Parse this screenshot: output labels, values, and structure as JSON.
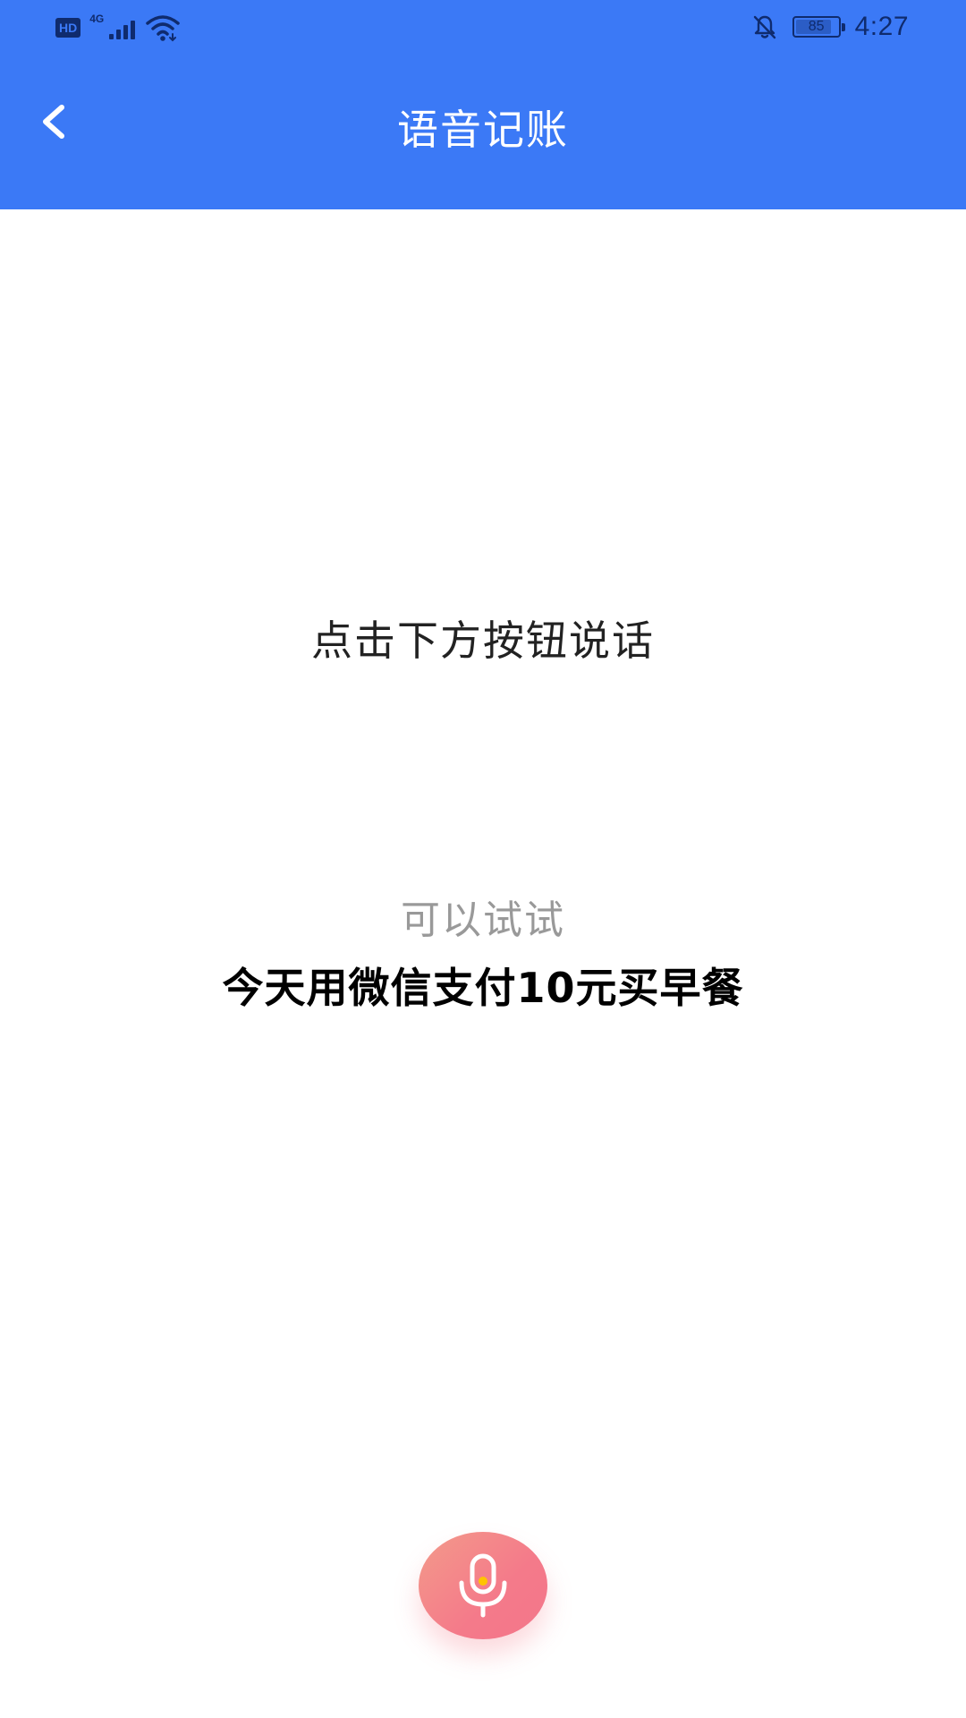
{
  "status_bar": {
    "hd_badge": "HD",
    "network_type": "4G",
    "battery_level": "85",
    "battery_fraction": 0.85,
    "time": "4:27",
    "icons": [
      "hd-icon",
      "signal-icon",
      "wifi-icon",
      "notifications-off-icon",
      "battery-icon"
    ]
  },
  "app_bar": {
    "title": "语音记账",
    "back_icon": "chevron-left-icon"
  },
  "main": {
    "instruction": "点击下方按钮说话",
    "hint_label": "可以试试",
    "hint_example": "今天用微信支付10元买早餐"
  },
  "mic_button": {
    "icon": "microphone-icon"
  },
  "colors": {
    "header_bg": "#3b79f6",
    "status_icons": "#0f2b6e",
    "title_text": "#ffffff",
    "instruction_text": "#222222",
    "hint_label_text": "#999999",
    "hint_example_text": "#000000",
    "mic_gradient_start": "#f39a8a",
    "mic_gradient_end": "#f3768b",
    "mic_dot": "#ffc400"
  }
}
